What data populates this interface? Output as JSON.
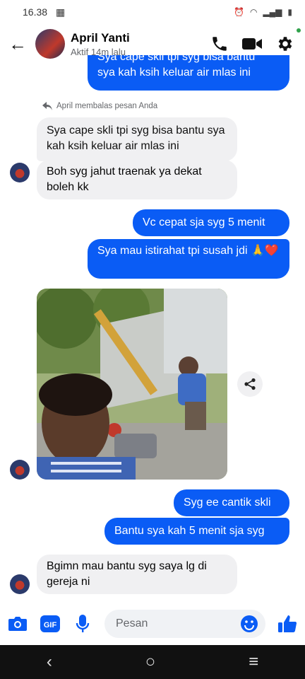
{
  "status": {
    "time": "16.38"
  },
  "header": {
    "name": "April Yanti",
    "status": "Aktif 14m lalu"
  },
  "messages": {
    "top_cut": "sya kah ksih keluar air mlas ini",
    "top_cut_upper": "Sya cape skli tpi syg bisa bantu",
    "reply_note": "April membalas pesan Anda",
    "quoted": "Sya cape skli tpi syg bisa bantu sya kah ksih keluar air mlas ini",
    "in1": "Boh syg jahut traenak ya dekat boleh kk",
    "out1": "Vc cepat sja syg 5 menit",
    "out2": "Sya mau istirahat tpi susah jdi 🙏❤️",
    "out3": "Syg ee cantik skli",
    "out4": "Bantu sya kah 5 menit sja syg",
    "in2": "Bgimn mau bantu syg saya lg di gereja ni"
  },
  "composer": {
    "placeholder": "Pesan"
  },
  "colors": {
    "accent": "#0a5cf5",
    "incoming": "#f0f0f2",
    "online": "#31a24c"
  },
  "icons": [
    "back-arrow-icon",
    "phone-icon",
    "video-icon",
    "gear-icon",
    "share-icon",
    "camera-icon",
    "gif-icon",
    "microphone-icon",
    "emoji-icon",
    "like-icon",
    "nav-back-icon",
    "nav-home-icon",
    "nav-recents-icon"
  ]
}
